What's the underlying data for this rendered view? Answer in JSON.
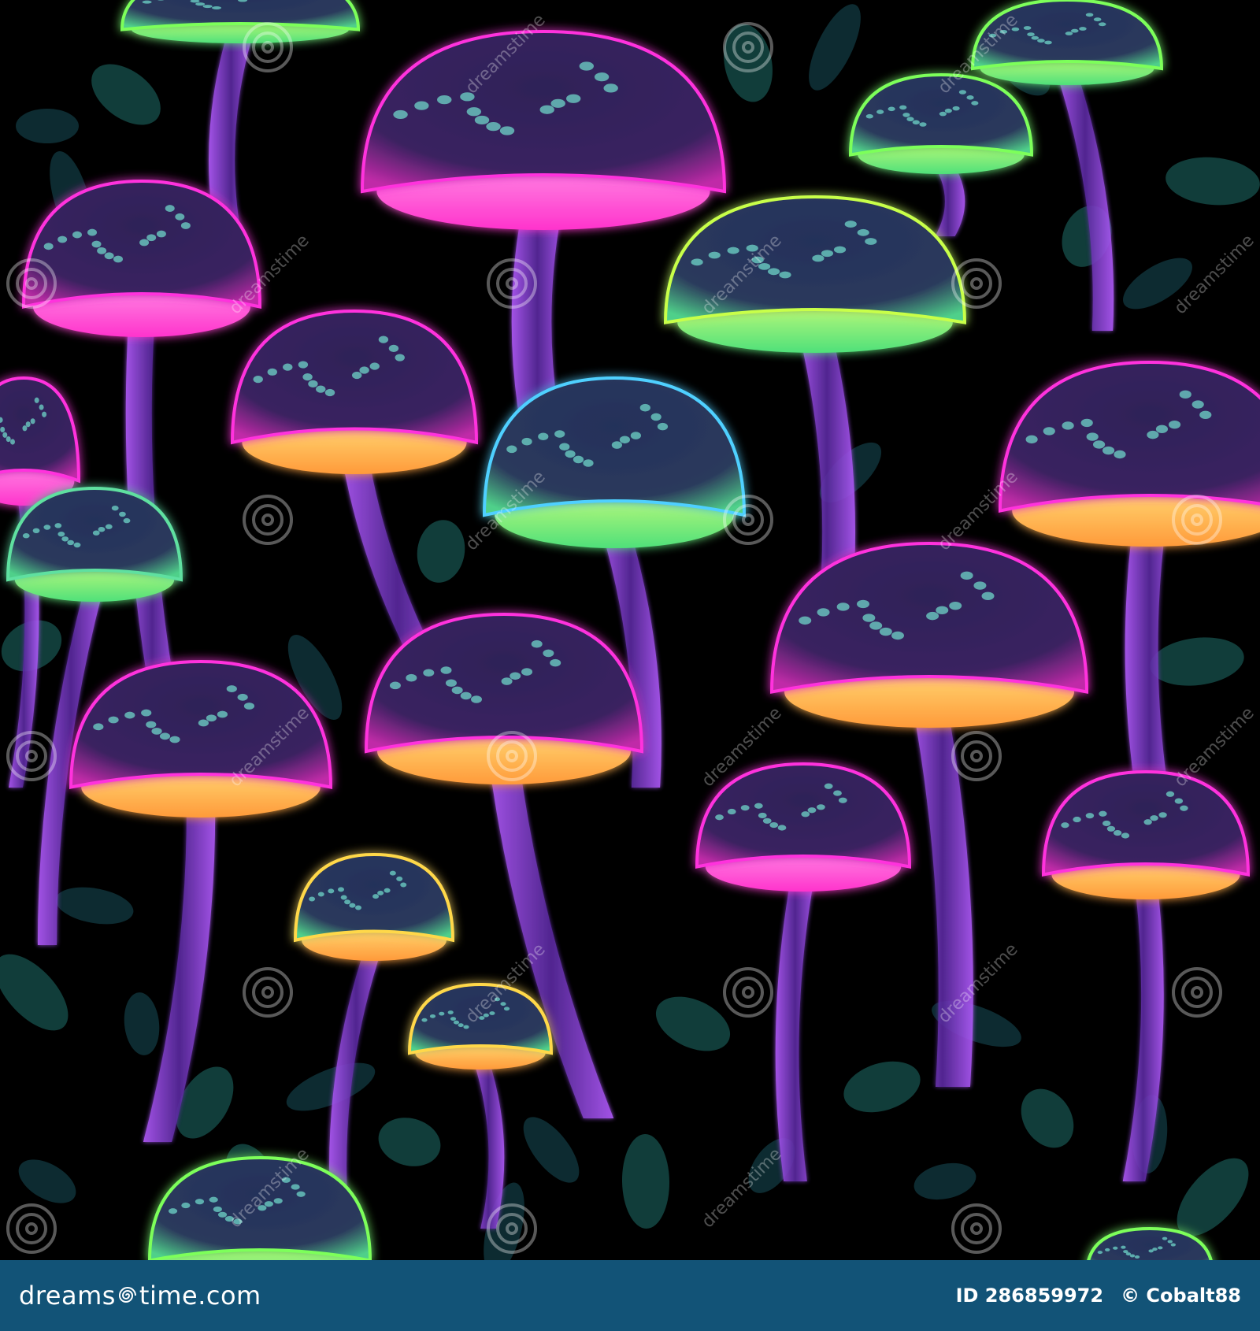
{
  "image": {
    "subject": "",
    "colors": {
      "background": "#000000",
      "stem": "#7a3cc8",
      "stem_edge": "#b45cff",
      "cap_dark": "#2a1d4f",
      "glow_pink": "#ff33dd",
      "glow_yellow": "#ffd84a",
      "glow_green": "#7dff5a",
      "foliage": "#1f6f6a"
    }
  },
  "watermark": {
    "text": "dreamstime",
    "icon": "swirl-logo-icon"
  },
  "footer": {
    "brand_prefix": "dreams",
    "brand_suffix": "time.com",
    "brand_icon": "swirl-logo-icon",
    "id_label": "ID 286859972",
    "copyright": "© Cobalt88",
    "background_color": "#125377"
  }
}
